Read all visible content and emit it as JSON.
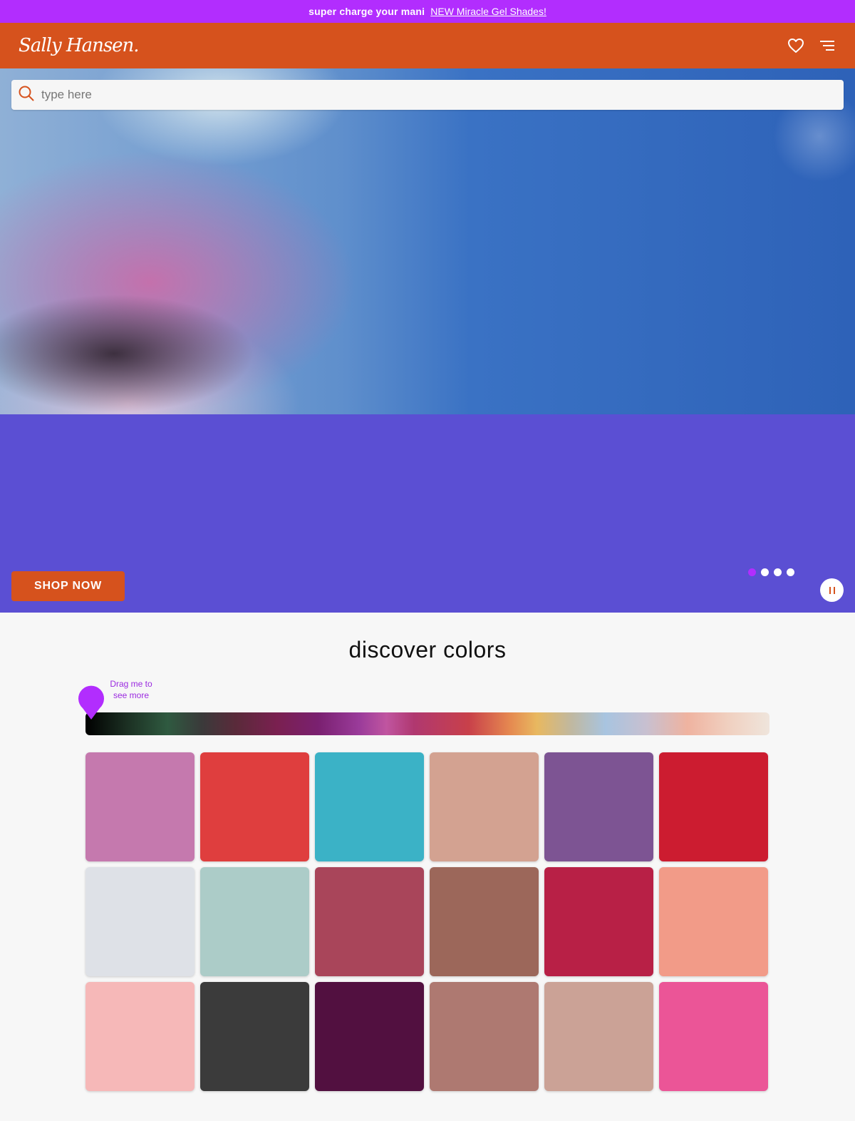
{
  "promo": {
    "lead_text": "super charge your mani",
    "link_text": "NEW Miracle Gel Shades!"
  },
  "header": {
    "logo_text": "Sally Hansen."
  },
  "search": {
    "placeholder": "type here"
  },
  "hero": {
    "cta_label": "SHOP NOW",
    "carousel_slides": 4,
    "active_slide": 1
  },
  "discover": {
    "title": "discover colors",
    "drag_hint_line1": "Drag me to",
    "drag_hint_line2": "see more",
    "swatches": [
      "#c579ae",
      "#df3e3e",
      "#3bb2c6",
      "#d3a291",
      "#7d5493",
      "#cc1c30",
      "#dee1e7",
      "#acccc8",
      "#a9455a",
      "#9c675a",
      "#b82046",
      "#f29b88",
      "#f6b8b8",
      "#3b3b3b",
      "#521040",
      "#ae7971",
      "#cba296",
      "#eb5597"
    ]
  },
  "colors": {
    "brand_orange": "#d6521d",
    "brand_purple": "#b22dfe",
    "hero_panel": "#5b4fd3"
  }
}
